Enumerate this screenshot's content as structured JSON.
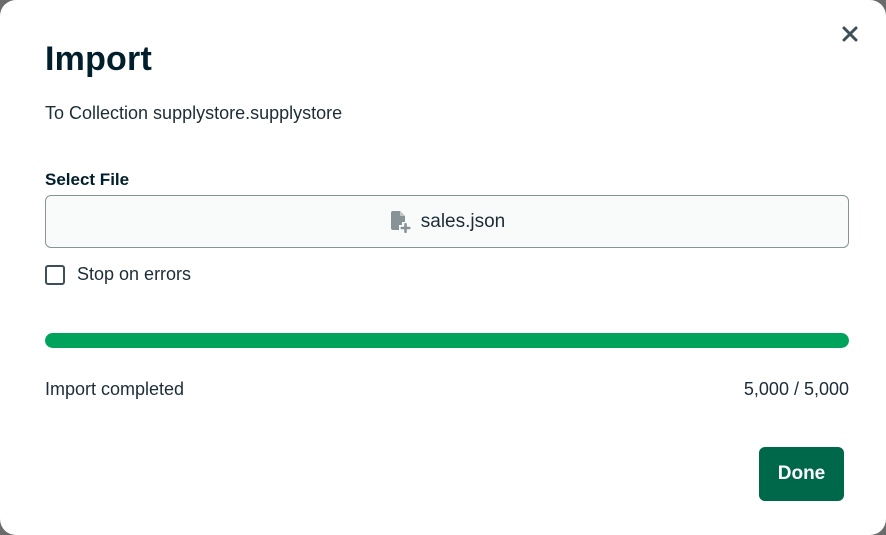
{
  "modal": {
    "title": "Import",
    "subtitle": "To Collection supplystore.supplystore",
    "close_icon": "close-icon"
  },
  "file_select": {
    "label": "Select File",
    "file_name": "sales.json",
    "icon": "file-add-icon"
  },
  "options": {
    "stop_on_errors_label": "Stop on errors",
    "stop_on_errors_checked": false
  },
  "progress": {
    "fraction": 1.0,
    "status": "Import completed",
    "count": "5,000 / 5,000",
    "color": "#00a35c"
  },
  "actions": {
    "done_label": "Done",
    "done_color": "#00684a"
  }
}
